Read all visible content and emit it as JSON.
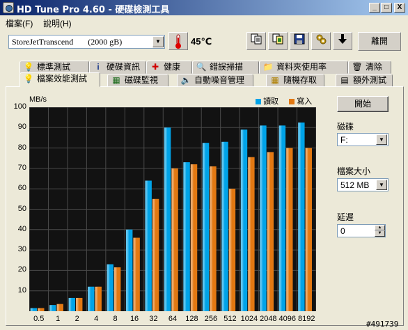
{
  "window": {
    "title": "HD Tune Pro 4.60 - 硬碟檢測工具",
    "minimize": "_",
    "maximize": "□",
    "close": "X"
  },
  "menu": [
    {
      "label": "檔案(F)"
    },
    {
      "label": "說明(H)"
    }
  ],
  "toolbar": {
    "drive": "StoreJetTranscend       (2000 gB)",
    "temperature": "45℃",
    "exit_label": "離開",
    "icons": [
      "thermometer-icon",
      "copy-text-icon",
      "copy-screenshot-icon",
      "save-icon",
      "options-icon",
      "down-arrow-icon"
    ]
  },
  "tabs_row1": [
    {
      "label": "標準測試",
      "icon": "💡"
    },
    {
      "label": "硬碟資訊",
      "icon": "i"
    },
    {
      "label": "健康",
      "icon": "✚"
    },
    {
      "label": "錯誤掃描",
      "icon": "🔍"
    },
    {
      "label": "資料夾使用率",
      "icon": "📁"
    },
    {
      "label": "清除",
      "icon": "🗑"
    }
  ],
  "tabs_row2": [
    {
      "label": "檔案效能測試",
      "icon": "💡",
      "active": true
    },
    {
      "label": "磁碟監視",
      "icon": "▦"
    },
    {
      "label": "自動噪音管理",
      "icon": "🔈"
    },
    {
      "label": "隨機存取",
      "icon": "▦"
    },
    {
      "label": "額外測試",
      "icon": "▤"
    }
  ],
  "side": {
    "start_label": "開始",
    "disk_label": "磁碟",
    "disk_value": "F:",
    "filesize_label": "檔案大小",
    "filesize_value": "512 MB",
    "delay_label": "延遲",
    "delay_value": "0"
  },
  "status_id": "#491739",
  "colors": {
    "read": "#00a3e8",
    "write": "#e27812",
    "chart_bg": "#121212",
    "grid": "#4a4a4a"
  },
  "chart_data": {
    "type": "bar",
    "ylabel": "MB/s",
    "ylim": [
      0,
      100
    ],
    "yticks": [
      10,
      20,
      30,
      40,
      50,
      60,
      70,
      80,
      90,
      100
    ],
    "categories": [
      "0.5",
      "1",
      "2",
      "4",
      "8",
      "16",
      "32",
      "64",
      "128",
      "256",
      "512",
      "1024",
      "2048",
      "4096",
      "8192"
    ],
    "series": [
      {
        "name": "讀取",
        "color": "#00a3e8",
        "values": [
          1.5,
          3,
          6.5,
          12,
          23,
          40,
          64,
          90,
          73,
          82.5,
          83,
          89,
          91,
          91,
          92.5
        ]
      },
      {
        "name": "寫入",
        "color": "#e27812",
        "values": [
          1.5,
          3.5,
          6.5,
          12,
          21.5,
          36,
          55,
          70,
          72,
          71,
          60,
          75.5,
          78,
          80,
          80
        ]
      }
    ],
    "grid": true,
    "legend": "top-right"
  }
}
